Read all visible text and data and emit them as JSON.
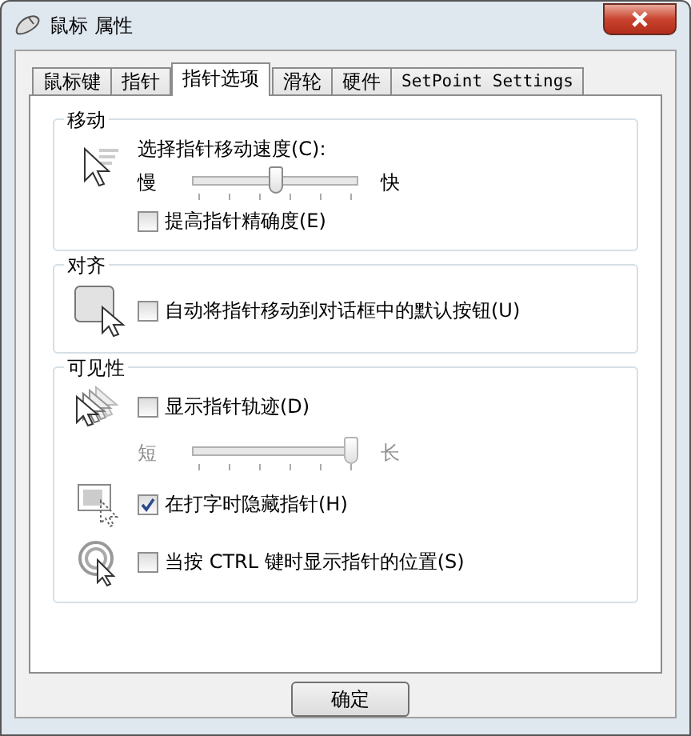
{
  "window": {
    "title": "鼠标 属性"
  },
  "tabs": [
    {
      "label": "鼠标键",
      "selected": false
    },
    {
      "label": "指针",
      "selected": false
    },
    {
      "label": "指针选项",
      "selected": true
    },
    {
      "label": "滑轮",
      "selected": false
    },
    {
      "label": "硬件",
      "selected": false
    },
    {
      "label": "SetPoint Settings",
      "selected": false
    }
  ],
  "groups": [
    {
      "title": "移动",
      "rows": [
        {
          "kind": "speed-slider",
          "label": "选择指针移动速度(C):",
          "min_label": "慢",
          "max_label": "快",
          "level": 0.5
        },
        {
          "kind": "check",
          "label": "提高指针精确度(E)",
          "checked": false
        }
      ]
    },
    {
      "title": "对齐",
      "rows": [
        {
          "kind": "snap-check",
          "label": "自动将指针移动到对话框中的默认按钮(U)",
          "checked": false
        }
      ]
    },
    {
      "title": "可见性",
      "rows": [
        {
          "kind": "trail-check",
          "label": "显示指针轨迹(D)",
          "checked": false
        },
        {
          "kind": "trail-slider",
          "min_label": "短",
          "max_label": "长",
          "level": 1,
          "disabled": true
        },
        {
          "kind": "hide-check",
          "label": "在打字时隐藏指针(H)",
          "checked": true
        },
        {
          "kind": "locate-check",
          "label": "当按 CTRL 键时显示指针的位置(S)",
          "checked": false
        }
      ]
    }
  ],
  "buttons": [
    "确定"
  ]
}
